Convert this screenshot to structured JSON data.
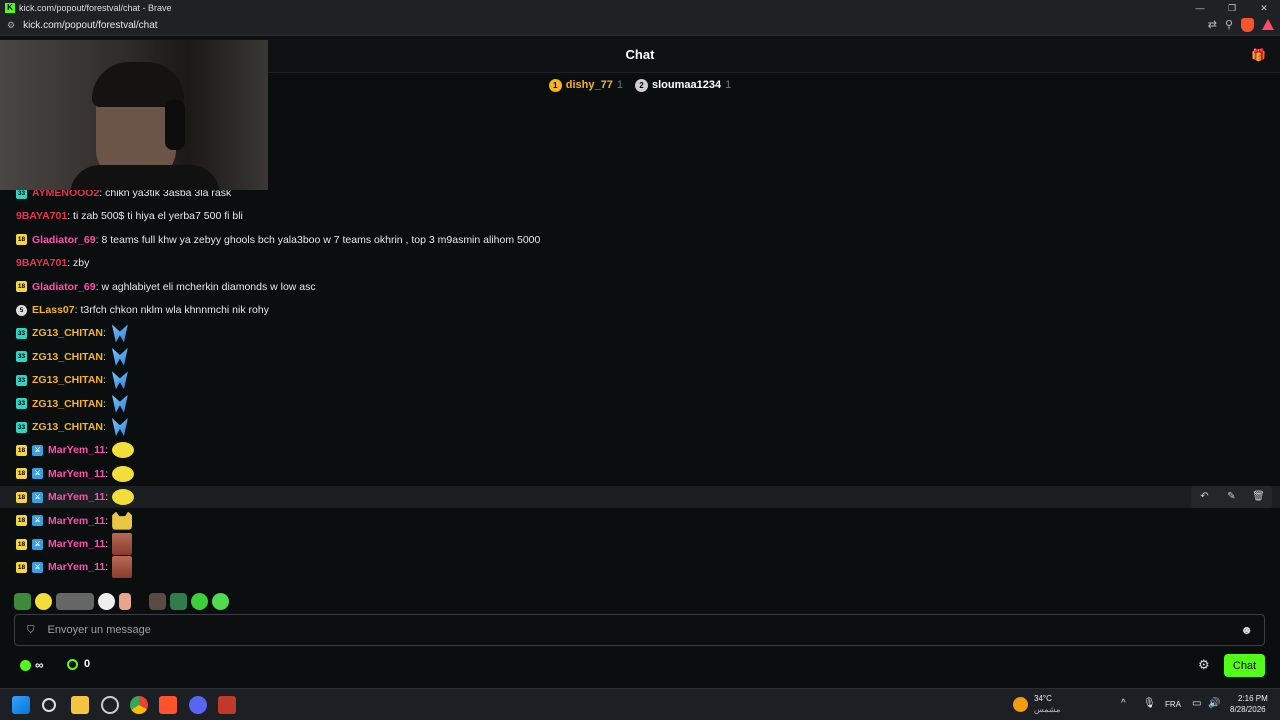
{
  "browser": {
    "window_title": "kick.com/popout/forestval/chat - Brave",
    "url": "kick.com/popout/forestval/chat",
    "logo_letter": "K"
  },
  "chat": {
    "title": "Chat",
    "leaderboard": [
      {
        "rank": "1",
        "name": "dishy_77",
        "count": "1",
        "color": "#f5b423",
        "name_color": "#f5b423"
      },
      {
        "rank": "2",
        "name": "sloumaa1234",
        "count": "1",
        "color": "#cfcfcf",
        "name_color": "#ffffff"
      }
    ],
    "messages": [
      {
        "badge": "33",
        "badge_type": "sub33",
        "user": "AYMENOOO2",
        "user_color": "#e8344e",
        "text": ": chikn ya3tik 3asba 3la rask"
      },
      {
        "badge": "",
        "badge_type": "",
        "user": "9BAYA701",
        "user_color": "#e8344e",
        "text": ": ti zab 500$ ti hiya el yerba7 500 fi bli"
      },
      {
        "badge": "18",
        "badge_type": "sub18",
        "user": "Gladiator_69",
        "user_color": "#ff4fb0",
        "text": ": 8 teams full khw ya zebyy ghools bch yala3boo w 7 teams okhrin , top 3 m9asmin alihom 5000"
      },
      {
        "badge": "",
        "badge_type": "",
        "user": "9BAYA701",
        "user_color": "#e8344e",
        "text": ": zby"
      },
      {
        "badge": "18",
        "badge_type": "sub18",
        "user": "Gladiator_69",
        "user_color": "#ff4fb0",
        "text": ": w aghlabiyet eli mcherkin diamonds w low asc"
      },
      {
        "badge": "5",
        "badge_type": "circle",
        "user": "ELass07",
        "user_color": "#f5b423",
        "text": ": t3rfch chkon nklm wla khnnmchi nik rohy"
      },
      {
        "badge": "33",
        "badge_type": "sub33",
        "user": "ZG13_CHITAN",
        "user_color": "#f5b423",
        "text": ":",
        "emote": "wings"
      },
      {
        "badge": "33",
        "badge_type": "sub33",
        "user": "ZG13_CHITAN",
        "user_color": "#f5b423",
        "text": ":",
        "emote": "wings"
      },
      {
        "badge": "33",
        "badge_type": "sub33",
        "user": "ZG13_CHITAN",
        "user_color": "#f5b423",
        "text": ":",
        "emote": "wings"
      },
      {
        "badge": "33",
        "badge_type": "sub33",
        "user": "ZG13_CHITAN",
        "user_color": "#f5b423",
        "text": ":",
        "emote": "wings"
      },
      {
        "badge": "33",
        "badge_type": "sub33",
        "user": "ZG13_CHITAN",
        "user_color": "#f5b423",
        "text": ":",
        "emote": "wings"
      },
      {
        "badge": "18",
        "badge_type": "sub18",
        "mod": true,
        "user": "MarYem_11",
        "user_color": "#ff4fb0",
        "text": ":",
        "emote": "blob"
      },
      {
        "badge": "18",
        "badge_type": "sub18",
        "mod": true,
        "user": "MarYem_11",
        "user_color": "#ff4fb0",
        "text": ":",
        "emote": "blob"
      },
      {
        "badge": "18",
        "badge_type": "sub18",
        "mod": true,
        "user": "MarYem_11",
        "user_color": "#ff4fb0",
        "text": ":",
        "emote": "blob",
        "hover": true
      },
      {
        "badge": "18",
        "badge_type": "sub18",
        "mod": true,
        "user": "MarYem_11",
        "user_color": "#ff4fb0",
        "text": ":",
        "emote": "cat"
      },
      {
        "badge": "18",
        "badge_type": "sub18",
        "mod": true,
        "user": "MarYem_11",
        "user_color": "#ff4fb0",
        "text": ":",
        "emote": "face"
      },
      {
        "badge": "18",
        "badge_type": "sub18",
        "mod": true,
        "user": "MarYem_11",
        "user_color": "#ff4fb0",
        "text": ":",
        "emote": "face"
      }
    ],
    "hover_actions": [
      "reply-icon",
      "pin-icon",
      "delete-icon"
    ],
    "input_placeholder": "Envoyer un message",
    "points": "∞",
    "kicks": "0",
    "send_label": "Chat",
    "accent_color": "#53fc18"
  },
  "taskbar": {
    "weather_temp": "34°C",
    "weather_desc": "مشمس",
    "lang": "FRA",
    "time": "2:16 PM",
    "date": "8/28/2026"
  }
}
